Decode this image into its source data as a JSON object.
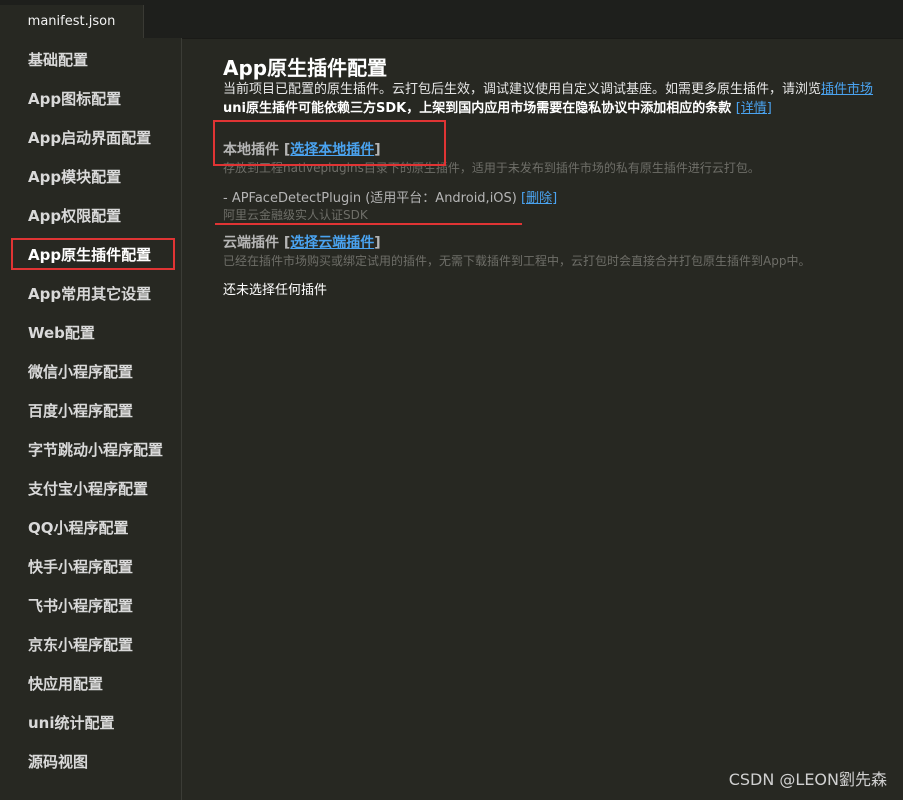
{
  "tab": {
    "label": "manifest.json"
  },
  "sidebar": {
    "items": [
      {
        "label": "基础配置"
      },
      {
        "label": "App图标配置"
      },
      {
        "label": "App启动界面配置"
      },
      {
        "label": "App模块配置"
      },
      {
        "label": "App权限配置"
      },
      {
        "label": "App原生插件配置"
      },
      {
        "label": "App常用其它设置"
      },
      {
        "label": "Web配置"
      },
      {
        "label": "微信小程序配置"
      },
      {
        "label": "百度小程序配置"
      },
      {
        "label": "字节跳动小程序配置"
      },
      {
        "label": "支付宝小程序配置"
      },
      {
        "label": "QQ小程序配置"
      },
      {
        "label": "快手小程序配置"
      },
      {
        "label": "飞书小程序配置"
      },
      {
        "label": "京东小程序配置"
      },
      {
        "label": "快应用配置"
      },
      {
        "label": "uni统计配置"
      },
      {
        "label": "源码视图"
      }
    ],
    "active_index": 5
  },
  "main": {
    "title": "App原生插件配置",
    "desc_line1": "当前项目已配置的原生插件。云打包后生效，调试建议使用自定义调试基座。如需更多原生插件，请浏览",
    "desc_line1_link": "插件市场",
    "desc_line2": "uni原生插件可能依赖三方SDK，上架到国内应用市场需要在隐私协议中添加相应的条款",
    "desc_line2_link": "[详情]",
    "local": {
      "heading": "本地插件",
      "open_bracket": "[",
      "link": "选择本地插件",
      "close_bracket": "]",
      "hint": "存放到工程nativeplugins目录下的原生插件，适用于未发布到插件市场的私有原生插件进行云打包。",
      "plugin_text": "- APFaceDetectPlugin (适用平台：Android,iOS)",
      "plugin_delete": "[删除]",
      "plugin_desc": "阿里云金融级实人认证SDK"
    },
    "cloud": {
      "heading": "云端插件",
      "open_bracket": "[",
      "link": "选择云端插件",
      "close_bracket": "]",
      "hint": "已经在插件市场购买或绑定试用的插件，无需下载插件到工程中，云打包时会直接合并打包原生插件到App中。",
      "empty_text": "还未选择任何插件"
    }
  },
  "watermark": "CSDN @LEON劉先森",
  "colors": {
    "background": "#272822",
    "link": "#4aa3f0",
    "highlight": "#e03434"
  }
}
